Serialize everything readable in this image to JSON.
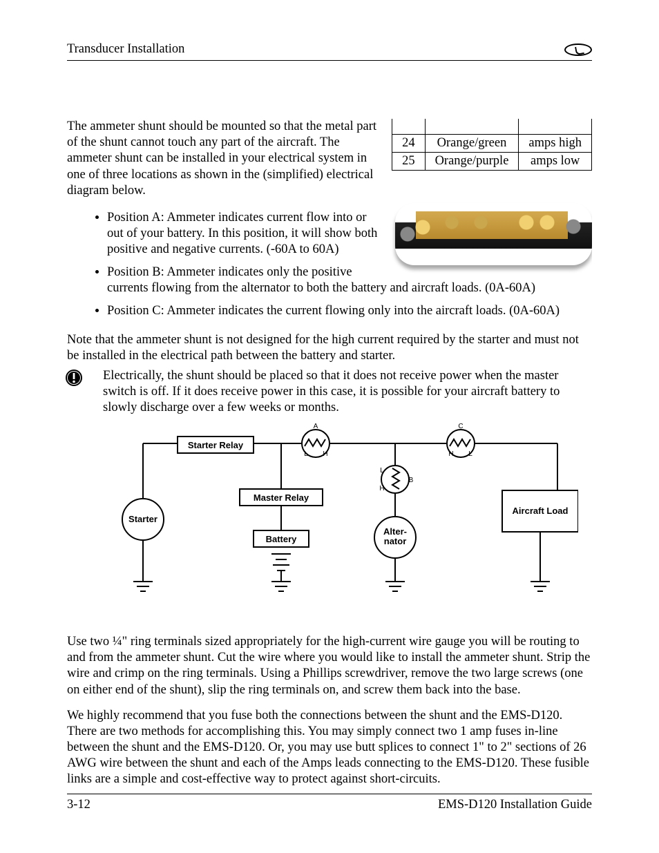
{
  "header": {
    "section": "Transducer Installation"
  },
  "intro": "The ammeter shunt should be mounted so that the metal part of the shunt cannot touch any part of the aircraft. The ammeter shunt can be installed in your electrical system in one of three locations as shown in the (simplified) electrical diagram below.",
  "wire_table": {
    "rows": [
      {
        "pin": "24",
        "color": "Orange/green",
        "func": "amps high"
      },
      {
        "pin": "25",
        "color": "Orange/purple",
        "func": "amps low"
      }
    ]
  },
  "positions": [
    "Position A: Ammeter indicates current flow into or out of your battery. In this position, it will show both positive and negative currents. (-60A to 60A)",
    "Position B: Ammeter indicates only the positive currents flowing from the alternator to both the battery and aircraft loads. (0A-60A)",
    "Position C: Ammeter indicates the current flowing only into the aircraft loads. (0A-60A)"
  ],
  "note": "Note that the ammeter shunt is not designed for the high current required by the starter and must not be installed in the electrical path between the battery and starter.",
  "caution": "Electrically, the shunt should be placed so that it does not receive power when the master switch is off. If it does receive power in this case, it is possible for your aircraft battery to slowly discharge over a few weeks or months.",
  "diagram": {
    "labels": {
      "starter_relay": "Starter Relay",
      "master_relay": "Master Relay",
      "battery": "Battery",
      "starter": "Starter",
      "alternator": "Alter-\nnator",
      "aircraft_load": "Aircraft Load",
      "a": "A",
      "b": "B",
      "c": "C",
      "l": "L",
      "h": "H"
    }
  },
  "ring_terminals": "Use two ¼\" ring terminals sized appropriately for the high-current wire gauge you will be routing to and from the ammeter shunt. Cut the wire where you would like to install the ammeter shunt. Strip the wire and crimp on the ring terminals. Using a Phillips screwdriver, remove the two large screws (one on either end of the shunt), slip the ring terminals on, and screw them back into the base.",
  "fuse": "We highly recommend that you fuse both the connections between the shunt and the EMS-D120. There are two methods for accomplishing this. You may simply connect two 1 amp fuses in-line between the shunt and the EMS-D120. Or, you may use butt splices to connect 1\" to 2\" sections of 26 AWG wire between the shunt and each of the Amps leads connecting to the EMS-D120. These fusible links are a simple and cost-effective way to protect against short-circuits.",
  "footer": {
    "page": "3-12",
    "doc": "EMS-D120 Installation Guide"
  }
}
